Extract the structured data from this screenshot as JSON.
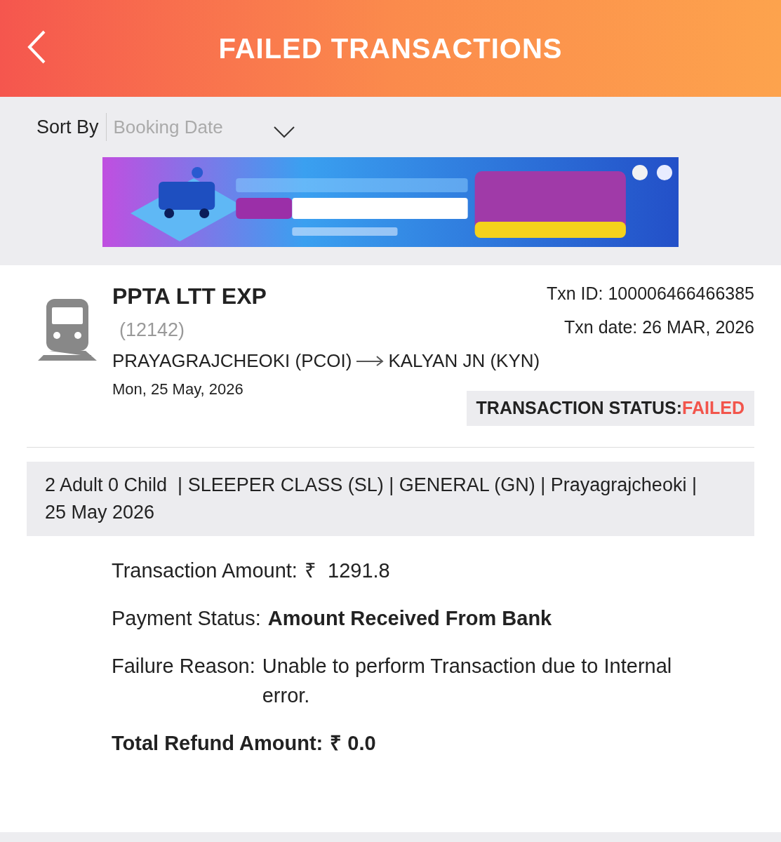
{
  "header": {
    "title": "FAILED TRANSACTIONS"
  },
  "sort": {
    "label": "Sort By",
    "value": "Booking Date"
  },
  "transaction": {
    "train_name": "PPTA LTT EXP",
    "train_number": "(12142)",
    "from": "PRAYAGRAJCHEOKI (PCOI)",
    "to": "KALYAN JN (KYN)",
    "journey_date": "Mon, 25 May, 2026",
    "txn_id": "Txn ID: 100006466466385",
    "txn_date": "Txn date: 26 MAR, 2026",
    "status_label": "TRANSACTION STATUS:",
    "status_value": "FAILED",
    "summary": "2 Adult 0 Child  | SLEEPER CLASS (SL) | GENERAL (GN) | Prayagrajcheoki | 25 May 2026",
    "details": [
      {
        "kind": "plain",
        "label": "Transaction Amount:",
        "value": "₹  1291.8"
      },
      {
        "kind": "bold_value",
        "label": "Payment Status:",
        "value": "Amount Received From Bank"
      },
      {
        "kind": "plain",
        "label": "Failure Reason:",
        "value": "Unable to perform Transaction due to Internal error."
      },
      {
        "kind": "bold_all",
        "label": "Total Refund Amount:",
        "value": "₹ 0.0"
      }
    ]
  }
}
